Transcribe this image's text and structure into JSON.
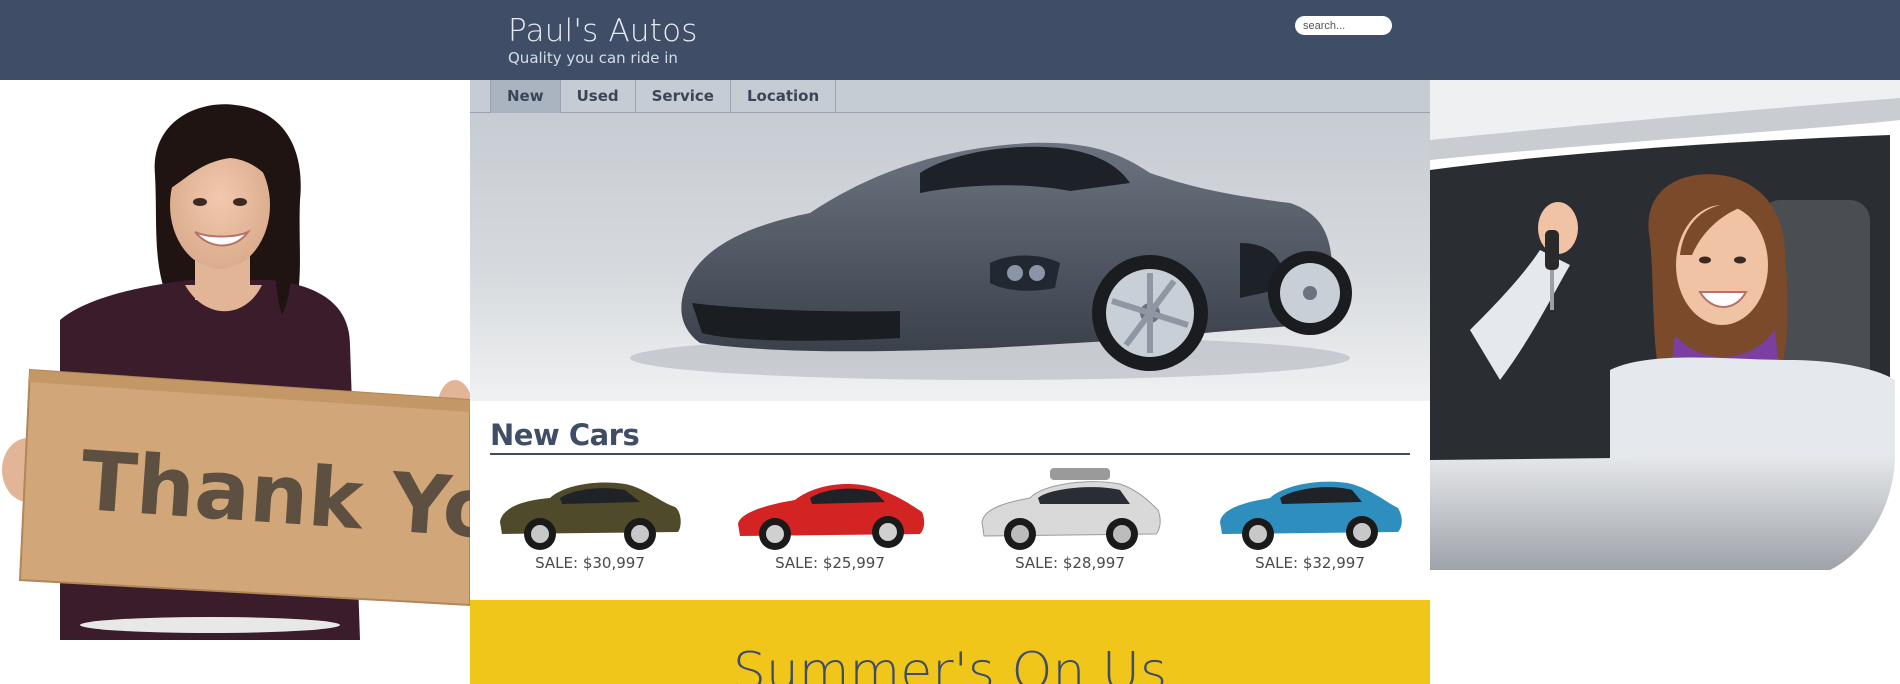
{
  "header": {
    "title": "Paul's Autos",
    "tagline": "Quality you can ride in",
    "search_placeholder": "search..."
  },
  "nav": {
    "items": [
      {
        "label": "New",
        "active": true
      },
      {
        "label": "Used",
        "active": false
      },
      {
        "label": "Service",
        "active": false
      },
      {
        "label": "Location",
        "active": false
      }
    ]
  },
  "side_left": {
    "sign_text": "Thank You!"
  },
  "section": {
    "title": "New Cars"
  },
  "cars": [
    {
      "price": "SALE: $30,997",
      "color": "#4f4a2a"
    },
    {
      "price": "SALE: $25,997",
      "color": "#d42323"
    },
    {
      "price": "SALE: $28,997",
      "color": "#d9d9d9"
    },
    {
      "price": "SALE: $32,997",
      "color": "#2e8fbf"
    }
  ],
  "banner": {
    "text": "Summer's On Us"
  },
  "colors": {
    "header_bg": "#3f4d66",
    "nav_bg": "#c6ccd4",
    "banner_bg": "#f1c61a"
  }
}
